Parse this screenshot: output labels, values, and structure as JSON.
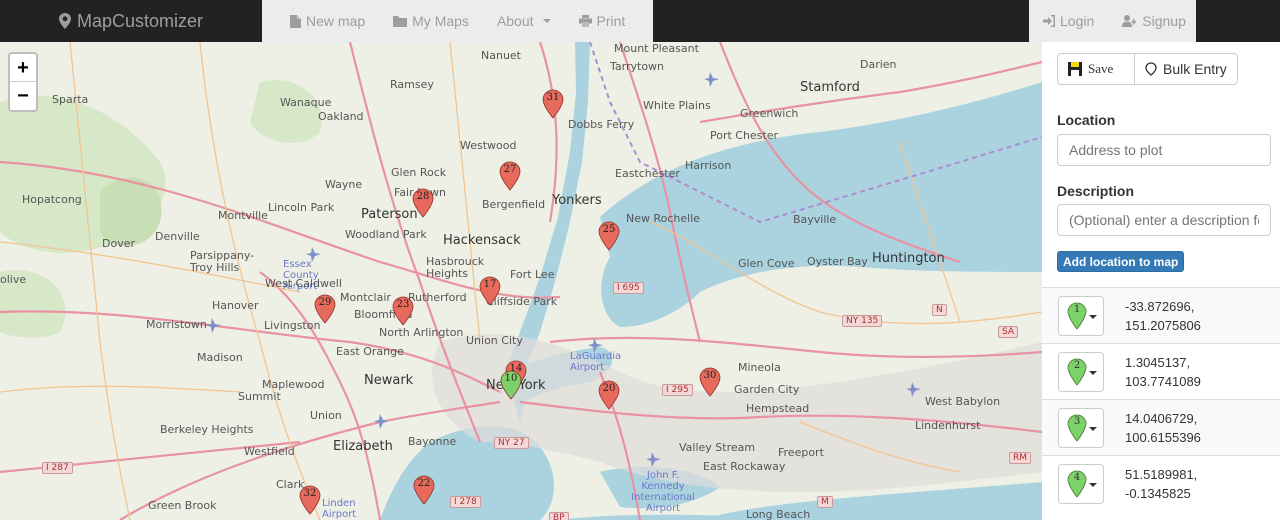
{
  "navbar": {
    "brand": "MapCustomizer",
    "items": [
      {
        "label": "New map",
        "icon": "file-icon"
      },
      {
        "label": "My Maps",
        "icon": "folder-icon"
      },
      {
        "label": "About",
        "icon": "caret-down"
      },
      {
        "label": "Print",
        "icon": "print-icon"
      }
    ],
    "right": [
      {
        "label": "Login",
        "icon": "login-icon"
      },
      {
        "label": "Signup",
        "icon": "user-plus-icon"
      }
    ]
  },
  "map": {
    "zoom_in": "+",
    "zoom_out": "−",
    "places": {
      "sparta": "Sparta",
      "wanaque": "Wanaque",
      "oakland": "Oakland",
      "ramsey": "Ramsey",
      "nanuet": "Nanuet",
      "mount_pleasant": "Mount Pleasant",
      "tarrytown": "Tarrytown",
      "darien": "Darien",
      "stamford": "Stamford",
      "white_plains": "White Plains",
      "dobbs_ferry": "Dobbs Ferry",
      "greenwich": "Greenwich",
      "port_chester": "Port Chester",
      "westwood": "Westwood",
      "glen_rock": "Glen Rock",
      "wayne": "Wayne",
      "fair_lawn": "Fair Lawn",
      "harrison": "Harrison",
      "eastchester": "Eastchester",
      "hopatcong": "Hopatcong",
      "lincoln_park": "Lincoln Park",
      "bergenfield": "Bergenfield",
      "yonkers": "Yonkers",
      "montville": "Montville",
      "paterson": "Paterson",
      "new_rochelle": "New Rochelle",
      "bayville": "Bayville",
      "denville": "Denville",
      "dover": "Dover",
      "woodland_park": "Woodland Park",
      "hackensack": "Hackensack",
      "parsippany": "Parsippany-Troy Hills",
      "essex_airport": "Essex County Airport",
      "hasbrouck": "Hasbrouck Heights",
      "fort_lee": "Fort Lee",
      "glen_cove": "Glen Cove",
      "oyster_bay": "Oyster Bay",
      "huntington": "Huntington",
      "west_caldwell": "West Caldwell",
      "olive": "olive",
      "hanover": "Hanover",
      "montclair": "Montclair",
      "rutherford": "Rutherford",
      "cliffside": "Cliffside Park",
      "morristown": "Morristown",
      "livingston": "Livingston",
      "bloomfield": "Bloomfield",
      "north_arlington": "North Arlington",
      "union_city": "Union City",
      "east_orange": "East Orange",
      "laguardia": "LaGuardia Airport",
      "madison": "Madison",
      "maplewood": "Maplewood",
      "newark": "Newark",
      "new_york": "New York",
      "mineola": "Mineola",
      "garden_city": "Garden City",
      "summit": "Summit",
      "hempstead": "Hempstead",
      "west_babylon": "West Babylon",
      "union": "Union",
      "berkeley_heights": "Berkeley Heights",
      "lindenhurst": "Lindenhurst",
      "elizabeth": "Elizabeth",
      "bayonne": "Bayonne",
      "westfield": "Westfield",
      "valley_stream": "Valley Stream",
      "freeport": "Freeport",
      "jfk": "John F. Kennedy International Airport",
      "east_rockaway": "East Rockaway",
      "clark": "Clark",
      "green_brook": "Green Brook",
      "linden_airport": "Linden Airport",
      "long_beach": "Long Beach"
    },
    "shields": {
      "i695": "I 695",
      "ny135": "NY 135",
      "n": "N",
      "sa": "SA",
      "i295": "I 295",
      "ny27": "NY 27",
      "i278": "I 278",
      "i287": "I 287",
      "rm": "RM",
      "m": "M",
      "bp": "BP"
    },
    "markers": [
      {
        "num": "31",
        "color": "#e86a5c"
      },
      {
        "num": "27",
        "color": "#e86a5c"
      },
      {
        "num": "28",
        "color": "#e86a5c"
      },
      {
        "num": "25",
        "color": "#e86a5c"
      },
      {
        "num": "17",
        "color": "#e86a5c"
      },
      {
        "num": "29",
        "color": "#e86a5c"
      },
      {
        "num": "23",
        "color": "#e86a5c"
      },
      {
        "num": "14",
        "color": "#e86a5c"
      },
      {
        "num": "10",
        "color": "#7ed06a"
      },
      {
        "num": "20",
        "color": "#e86a5c"
      },
      {
        "num": "30",
        "color": "#e86a5c"
      },
      {
        "num": "22",
        "color": "#e86a5c"
      },
      {
        "num": "32",
        "color": "#e86a5c"
      }
    ]
  },
  "sidebar": {
    "save_label": "Save",
    "bulk_label": "Bulk Entry",
    "location_label": "Location",
    "location_placeholder": "Address to plot",
    "description_label": "Description",
    "description_placeholder": "(Optional) enter a description for",
    "add_button": "Add location to map",
    "locations": [
      {
        "num": "1",
        "lat": "-33.872696,",
        "lng": "151.2075806"
      },
      {
        "num": "2",
        "lat": "1.3045137,",
        "lng": "103.7741089"
      },
      {
        "num": "3",
        "lat": "14.0406729,",
        "lng": "100.6155396"
      },
      {
        "num": "4",
        "lat": "51.5189981,",
        "lng": "-0.1345825"
      }
    ]
  },
  "colors": {
    "navbar": "#222222",
    "marker_red": "#e86a5c",
    "marker_green": "#7ed06a",
    "primary": "#337ab7",
    "water": "#aad3df"
  }
}
